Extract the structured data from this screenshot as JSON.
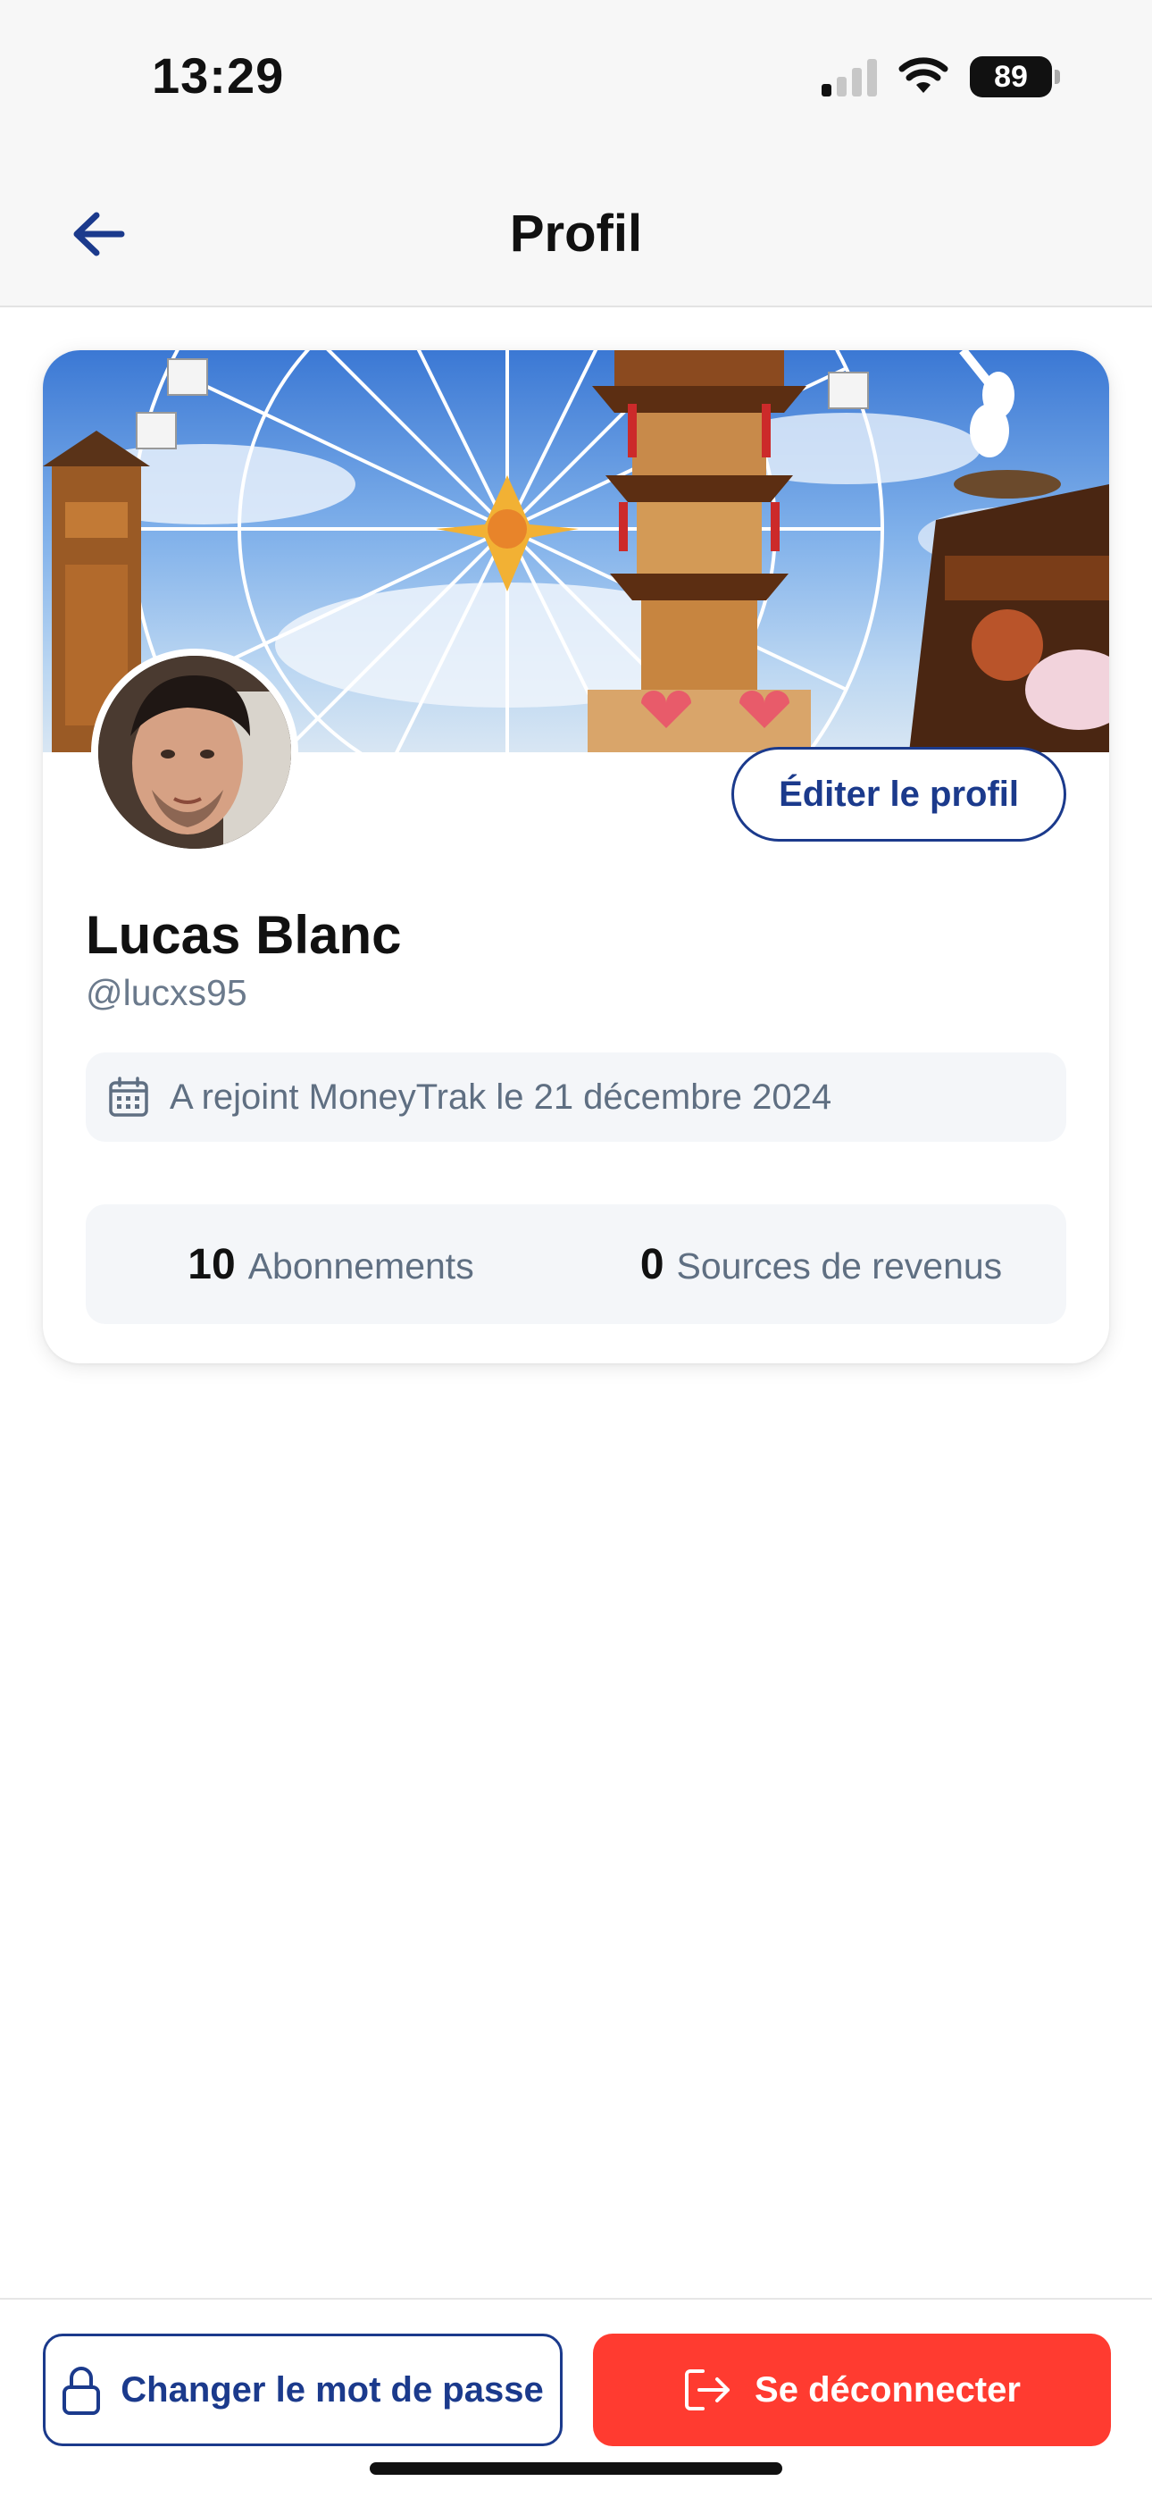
{
  "status_bar": {
    "time": "13:29",
    "battery": "89"
  },
  "nav": {
    "title": "Profil",
    "back_icon": "arrow-left-icon"
  },
  "profile": {
    "name": "Lucas Blanc",
    "handle": "@lucxs95",
    "edit_label": "Éditer le profil",
    "joined_text": "A rejoint MoneyTrak le 21 décembre 2024",
    "stats": [
      {
        "value": "10",
        "label": "Abonnements"
      },
      {
        "value": "0",
        "label": "Sources de revenus"
      }
    ]
  },
  "actions": {
    "change_password_label": "Changer le mot de passe",
    "logout_label": "Se déconnecter"
  },
  "colors": {
    "primary": "#1b3a8c",
    "danger": "#ff3b30",
    "muted_text": "#6b7a8c",
    "box_bg": "#f4f6f9"
  }
}
